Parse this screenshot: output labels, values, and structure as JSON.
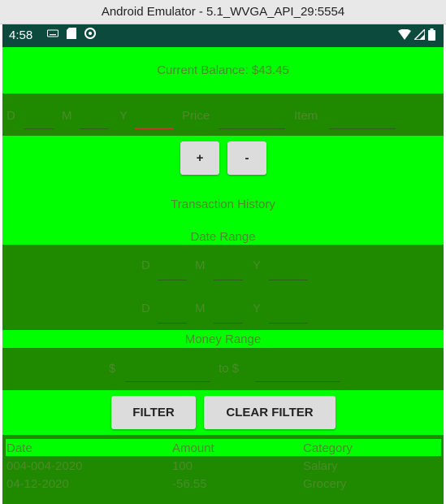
{
  "window": {
    "title": "Android Emulator - 5.1_WVGA_API_29:5554"
  },
  "status_bar": {
    "time": "4:58"
  },
  "balance": {
    "text": "Current Balance: $43.45"
  },
  "entry": {
    "d_label": "D",
    "m_label": "M",
    "y_label": "Y",
    "price_label": "Price",
    "item_label": "Item"
  },
  "actions": {
    "plus": "+",
    "minus": "-"
  },
  "history": {
    "title": "Transaction History",
    "date_range": "Date Range",
    "money_range": "Money Range"
  },
  "date_from": {
    "d": "D",
    "m": "M",
    "y": "Y"
  },
  "date_to": {
    "d": "D",
    "m": "M",
    "y": "Y"
  },
  "money": {
    "from_symbol": "$",
    "to_label": "to $"
  },
  "filter": {
    "filter_label": "FILTER",
    "clear_label": "CLEAR FILTER"
  },
  "table": {
    "headers": [
      "Date",
      "Amount",
      "Category"
    ],
    "rows": [
      [
        "004-004-2020",
        "100",
        "Salary"
      ],
      [
        "04-12-2020",
        "-56.55",
        "Grocery"
      ]
    ]
  },
  "colors": {
    "bright_green": "#00ff00",
    "dark_green": "#1f8a00",
    "status_bar": "#0b4a3d"
  }
}
